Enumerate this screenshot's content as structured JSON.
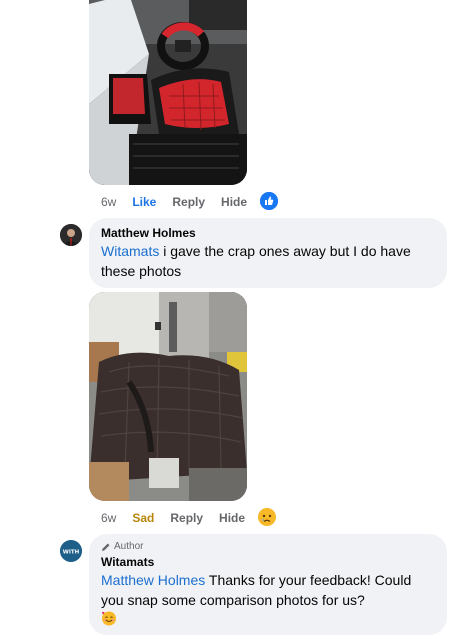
{
  "comment1": {
    "time": "6w",
    "like_label": "Like",
    "reply_label": "Reply",
    "hide_label": "Hide",
    "reaction_icon": "like-icon"
  },
  "comment2": {
    "author": "Matthew Holmes",
    "mention": "Witamats",
    "text": " i gave the crap ones away but I do have these photos",
    "time": "6w",
    "reaction_label": "Sad",
    "reply_label": "Reply",
    "hide_label": "Hide",
    "reaction_icon": "sad-icon"
  },
  "comment3": {
    "badge": "Author",
    "author": "Witamats",
    "avatar_text": "WITH",
    "mention": "Matthew Holmes",
    "text": " Thanks for your feedback! Could you snap some comparison photos for us?",
    "emoji": "🥰"
  },
  "colors": {
    "link_blue": "#1b6fd0",
    "like_blue": "#1877f2",
    "bubble_bg": "#f0f2f5",
    "meta_gray": "#65676b"
  }
}
